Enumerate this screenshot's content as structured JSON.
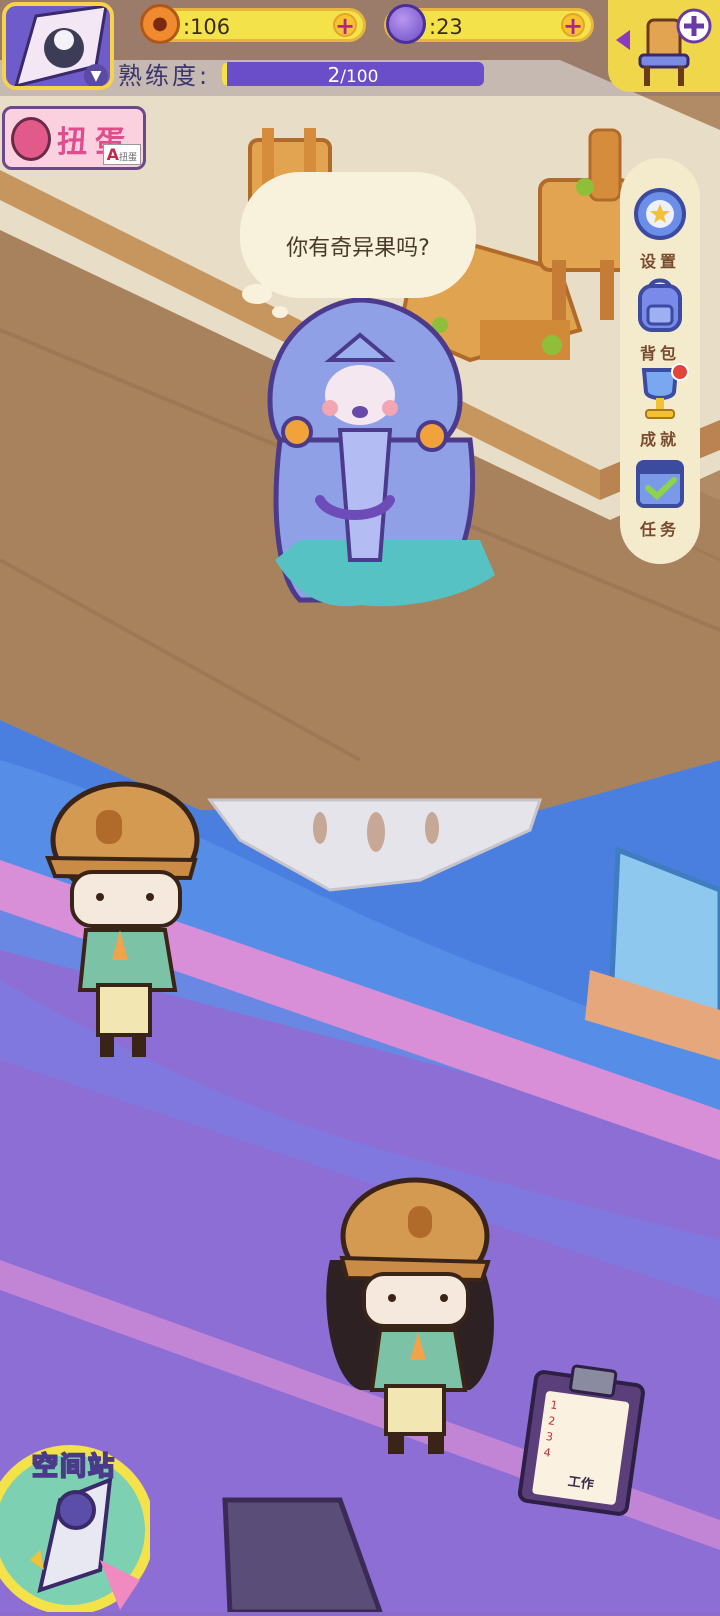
{
  "hud": {
    "coins_value": ":106",
    "planets_value": ":23",
    "proficiency_label": "熟练度:",
    "proficiency_current": "2",
    "proficiency_max": "/100",
    "proficiency_fraction": 0.02,
    "gacha_label": "扭蛋",
    "gacha_badge": "A",
    "gacha_badge_small": "扭蛋"
  },
  "side_menu": {
    "items": [
      {
        "label": "设置",
        "icon": "gear-star-icon"
      },
      {
        "label": "背包",
        "icon": "backpack-icon"
      },
      {
        "label": "成就",
        "icon": "trophy-icon"
      },
      {
        "label": "任务",
        "icon": "calendar-check-icon"
      }
    ]
  },
  "dialog": {
    "text": "你有奇异果吗?"
  },
  "bottom": {
    "space_station_label": "空间站",
    "work_label": "工作",
    "clipboard_rows": [
      "1",
      "2",
      "3",
      "4"
    ]
  },
  "colors": {
    "floor": "#b08b66",
    "floor_light": "#c9a47a",
    "water_blue": "#4a7fe0",
    "violet": "#8c6ed4",
    "pink_stripe": "#d98fd8",
    "gold": "#f3e24a"
  }
}
